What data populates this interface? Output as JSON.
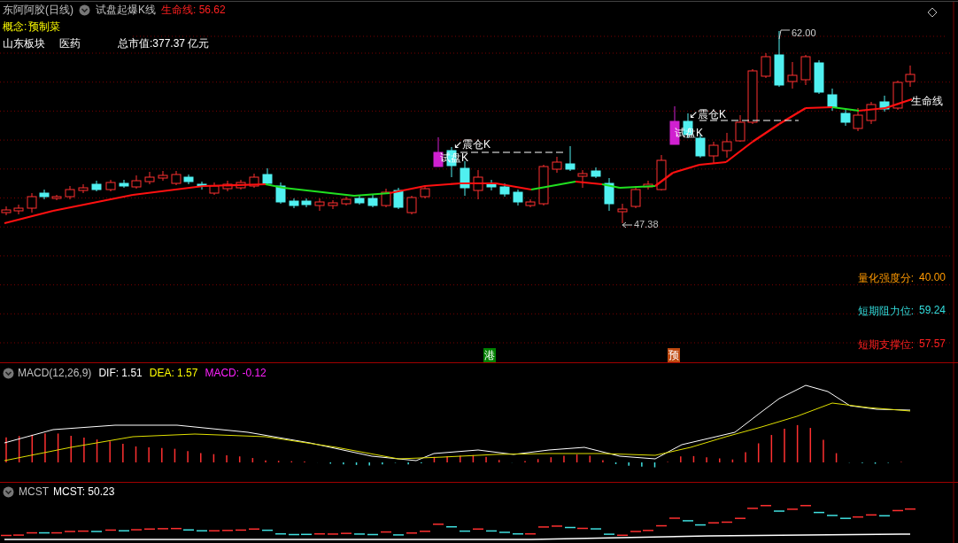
{
  "header": {
    "stock_title": "东阿阿胶(日线)",
    "indicator": "试盘起爆K线",
    "life_line": "生命线: 56.62"
  },
  "info": {
    "concept_label": "概念:",
    "concept": "预制菜",
    "region": "山东板块",
    "industry": "医药",
    "market_cap": "总市值:377.37 亿元"
  },
  "annotations": [
    {
      "kind": "high",
      "text": "62.00"
    },
    {
      "kind": "low",
      "text": "47.38"
    },
    {
      "kind": "line_label",
      "text": "生命线"
    },
    {
      "kind": "shakeout",
      "text": "↙震仓K"
    },
    {
      "kind": "probe",
      "text": "试盘K"
    },
    {
      "kind": "shakeout",
      "text": "↙震仓K"
    },
    {
      "kind": "probe",
      "text": "试盘K"
    }
  ],
  "metrics": [
    {
      "kind": "strength",
      "label": "量化强度分:",
      "value": "40.00"
    },
    {
      "kind": "resistance",
      "label": "短期阻力位:",
      "value": "59.24"
    },
    {
      "kind": "support",
      "label": "短期支撑位:",
      "value": "57.57"
    }
  ],
  "badges": [
    {
      "text": "港",
      "color": "#008000"
    },
    {
      "text": "预",
      "color": "#c04a10"
    }
  ],
  "macd": {
    "title": "MACD(12,26,9)",
    "dif": "DIF: 1.51",
    "dea": "DEA: 1.57",
    "macd": "MACD: -0.12"
  },
  "mcst": {
    "title": "MCST",
    "value": "MCST: 50.23"
  }
}
